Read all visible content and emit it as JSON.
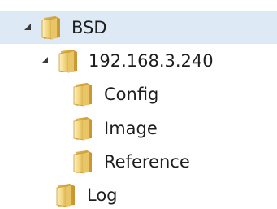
{
  "tree": {
    "nodes": [
      {
        "label": "BSD",
        "expanded": true,
        "selected": true,
        "icon": "folder-icon"
      },
      {
        "label": "192.168.3.240",
        "expanded": true,
        "selected": false,
        "icon": "folder-icon"
      },
      {
        "label": "Config",
        "selected": false,
        "icon": "folder-icon"
      },
      {
        "label": "Image",
        "selected": false,
        "icon": "folder-icon"
      },
      {
        "label": "Reference",
        "selected": false,
        "icon": "folder-icon"
      },
      {
        "label": "Log",
        "selected": false,
        "icon": "folder-icon"
      }
    ]
  },
  "colors": {
    "selection": "#dde9f5",
    "folder_light": "#f6e7a8",
    "folder_dark": "#d6a93c"
  }
}
